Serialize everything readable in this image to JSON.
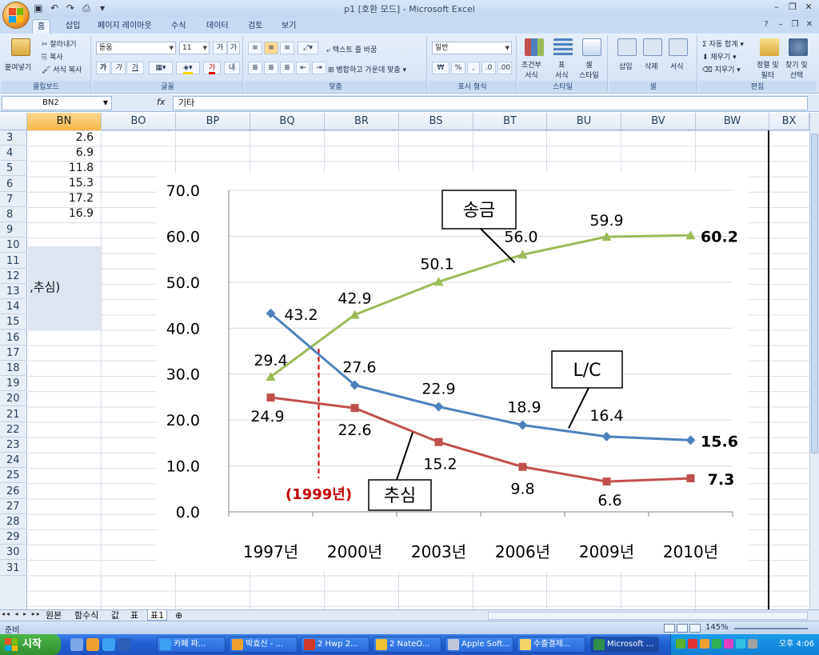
{
  "window": {
    "title": "p1  [호환 모드] - Microsoft Excel",
    "controls": [
      "–",
      "❐",
      "✕"
    ]
  },
  "ribbon": {
    "tabs": [
      "홈",
      "삽입",
      "페이지 레이아웃",
      "수식",
      "데이터",
      "검토",
      "보기"
    ],
    "active_tab": "홈",
    "clipboard": {
      "paste": "붙여넣기",
      "cut": "잘라내기",
      "copy": "복사",
      "format_painter": "서식 복사",
      "label": "클립보드"
    },
    "font": {
      "name": "돋움",
      "size": "11",
      "label": "글꼴",
      "bold": "가",
      "italic": "가",
      "underline": "가"
    },
    "alignment": {
      "wrap": "텍스트 줄 바꿈",
      "merge": "병합하고 가운데 맞춤",
      "label": "맞춤"
    },
    "number": {
      "format": "일반",
      "currency": "₩",
      "percent": "%",
      "comma": ",",
      "label": "표시 형식"
    },
    "styles": {
      "conditional": "조건부\n서식",
      "table": "표\n서식",
      "cell": "셀\n스타일",
      "label": "스타일"
    },
    "cells": {
      "insert": "삽입",
      "delete": "삭제",
      "format": "서식",
      "label": "셀"
    },
    "editing": {
      "autosum": "자동 합계",
      "fill": "채우기",
      "clear": "지우기",
      "sort": "정렬 및\n필터",
      "find": "찾기 및\n선택",
      "label": "편집"
    }
  },
  "formula_bar": {
    "name_box": "BN2",
    "fx": "fx",
    "content": "기타"
  },
  "columns": [
    "BN",
    "BO",
    "BP",
    "BQ",
    "BR",
    "BS",
    "BT",
    "BU",
    "BV",
    "BW",
    "BX"
  ],
  "rows": [
    "3",
    "4",
    "5",
    "6",
    "7",
    "8",
    "9",
    "10",
    "11",
    "12",
    "13",
    "14",
    "15",
    "16",
    "17",
    "18",
    "19",
    "20",
    "21",
    "22",
    "23",
    "24",
    "25",
    "26",
    "27",
    "28",
    "29",
    "30",
    "31"
  ],
  "bn_values": [
    "2.6",
    "6.9",
    "11.8",
    "15.3",
    "17.2",
    "16.9"
  ],
  "bn_text": ",추심)",
  "sheet_tabs": [
    "원본",
    "함수식",
    "값",
    "표",
    "표1"
  ],
  "active_sheet": "표1",
  "status": {
    "ready": "준비",
    "zoom": "145%"
  },
  "taskbar": {
    "start": "시작",
    "tasks": [
      "카페 파...",
      "박효신 - ...",
      "2 Hwp 2...",
      "2 NateO...",
      "Apple Soft...",
      "수출결제...",
      "Microsoft ..."
    ],
    "active_task": "Microsoft ...",
    "clock": "오후 4:06"
  },
  "chart_data": {
    "type": "line",
    "categories": [
      "1997년",
      "2000년",
      "2003년",
      "2006년",
      "2009년",
      "2010년"
    ],
    "ylim": [
      0,
      70
    ],
    "yticks": [
      "0.0",
      "10.0",
      "20.0",
      "30.0",
      "40.0",
      "50.0",
      "60.0",
      "70.0"
    ],
    "grid": true,
    "series": [
      {
        "name": "송금",
        "color": "#9bbb59",
        "marker": "triangle",
        "values": [
          29.4,
          42.9,
          50.1,
          56.0,
          59.9,
          60.2
        ],
        "labels": [
          "29.4",
          "42.9",
          "50.1",
          "56.0",
          "59.9",
          "60.2"
        ]
      },
      {
        "name": "L/C",
        "color": "#4f81bd",
        "marker": "diamond",
        "values": [
          43.2,
          27.6,
          22.9,
          18.9,
          16.4,
          15.6
        ],
        "labels": [
          "43.2",
          "27.6",
          "22.9",
          "18.9",
          "16.4",
          "15.6"
        ]
      },
      {
        "name": "추심",
        "color": "#c0504d",
        "marker": "square",
        "values": [
          24.9,
          22.6,
          15.2,
          9.8,
          6.6,
          7.3
        ],
        "labels": [
          "24.9",
          "22.6",
          "15.2",
          "9.8",
          "6.6",
          "7.3"
        ]
      }
    ],
    "annotation": {
      "text": "(1999년)",
      "color": "#c00000"
    }
  }
}
